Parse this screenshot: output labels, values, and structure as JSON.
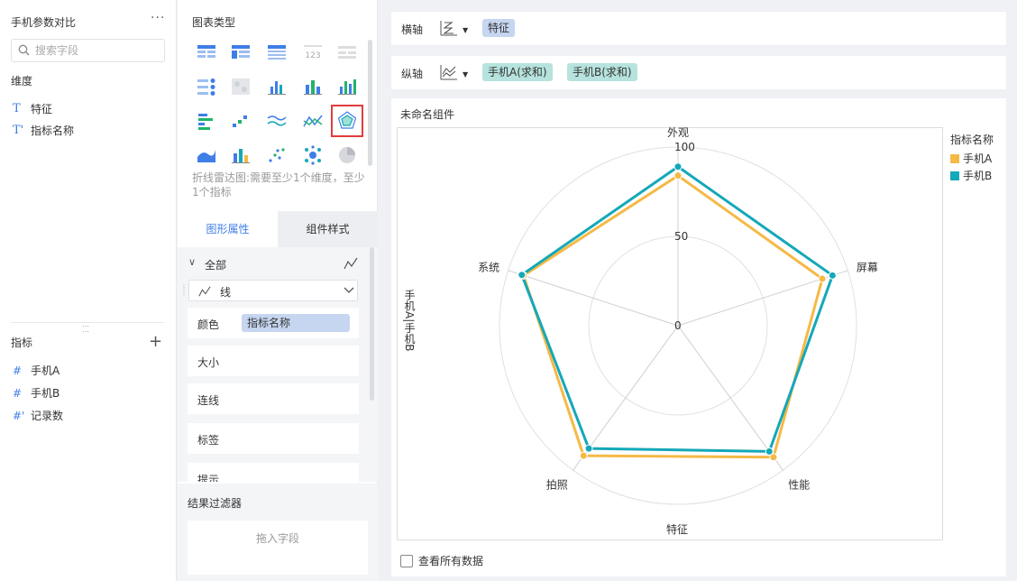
{
  "left_panel": {
    "title": "手机参数对比",
    "more_label": "···",
    "search": {
      "placeholder": "搜索字段",
      "value": ""
    },
    "dimension_section": "维度",
    "dimensions": [
      {
        "icon": "T",
        "label": "特征"
      },
      {
        "icon": "T'",
        "label": "指标名称"
      }
    ],
    "measure_section": "指标",
    "measures": [
      {
        "icon": "#",
        "label": "手机A"
      },
      {
        "icon": "#",
        "label": "手机B"
      },
      {
        "icon": "#'",
        "label": "记录数"
      }
    ]
  },
  "middle_panel": {
    "title": "图表类型",
    "selected_chart_type": "radar-line",
    "hint": "折线雷达图:需要至少1个维度，至少1个指标",
    "tabs": {
      "active": "图形属性",
      "inactive": "组件样式"
    },
    "props": {
      "group_label": "全部",
      "mark_type": "线",
      "color_label": "颜色",
      "color_field": "指标名称",
      "size_label": "大小",
      "connect_label": "连线",
      "label_label": "标签",
      "tooltip_label": "提示"
    },
    "filter": {
      "title": "结果过滤器",
      "placeholder": "拖入字段"
    }
  },
  "axes": {
    "x": {
      "label": "横轴",
      "fields": [
        "特征"
      ]
    },
    "y": {
      "label": "纵轴",
      "fields": [
        "手机A(求和)",
        "手机B(求和)"
      ]
    }
  },
  "chart_card": {
    "title": "未命名组件",
    "show_all_data": "查看所有数据"
  },
  "chart_data": {
    "type": "radar",
    "categories": [
      "外观",
      "屏幕",
      "性能",
      "拍照",
      "系统"
    ],
    "series": [
      {
        "name": "手机A",
        "values": [
          84,
          85,
          91,
          90,
          91
        ],
        "color": "#f5b946"
      },
      {
        "name": "手机B",
        "values": [
          89,
          91,
          87,
          85,
          92
        ],
        "color": "#14a8b9"
      }
    ],
    "radial_ticks": [
      "0",
      "50",
      "100"
    ],
    "rlim": [
      0,
      100
    ],
    "xlabel": "特征",
    "ylabel": "手机A|手机B",
    "legend": {
      "title": "指标名称",
      "position": "right-top"
    },
    "grid": true
  }
}
